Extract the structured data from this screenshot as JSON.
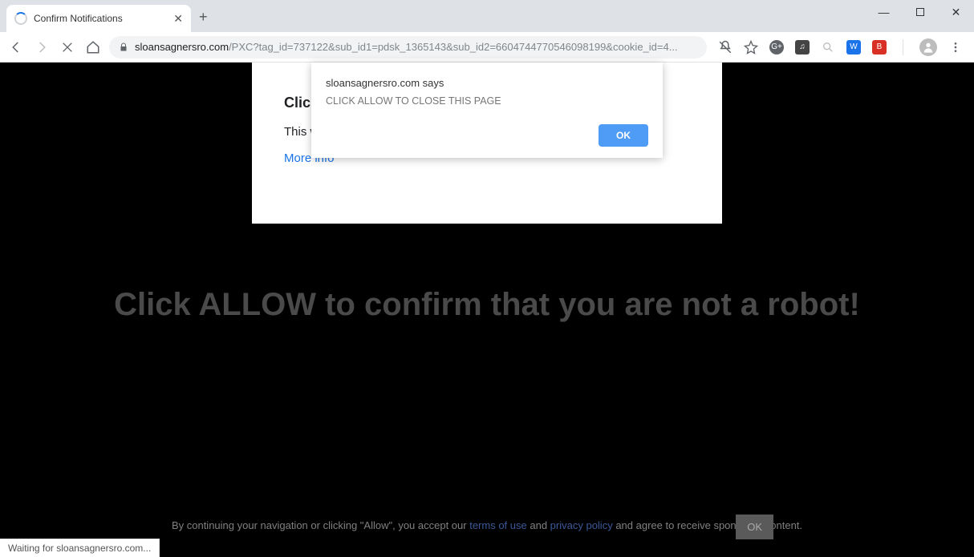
{
  "tab": {
    "title": "Confirm Notifications"
  },
  "url": {
    "host": "sloansagnersro.com",
    "path": "/PXC?tag_id=737122&sub_id1=pdsk_1365143&sub_id2=6604744770546098199&cookie_id=4..."
  },
  "dialog": {
    "origin": "sloansagnersro.com says",
    "message": "CLICK ALLOW TO CLOSE THIS PAGE",
    "ok": "OK"
  },
  "card": {
    "heading": "Click Allow",
    "body": "This website would like to show you notifications to continue browsing.",
    "more": "More info"
  },
  "hero": "Click ALLOW to confirm that you are not a robot!",
  "consent": {
    "pre": "By continuing your navigation or clicking \"Allow\", you accept our ",
    "tou": "terms of use",
    "mid": " and ",
    "pp": "privacy policy",
    "post": " and agree to receive sponsored content.",
    "ok": "OK"
  },
  "status": "Waiting for sloansagnersro.com...",
  "ext": {
    "g": "G+",
    "music": "♫",
    "w": "W",
    "b": "B"
  }
}
